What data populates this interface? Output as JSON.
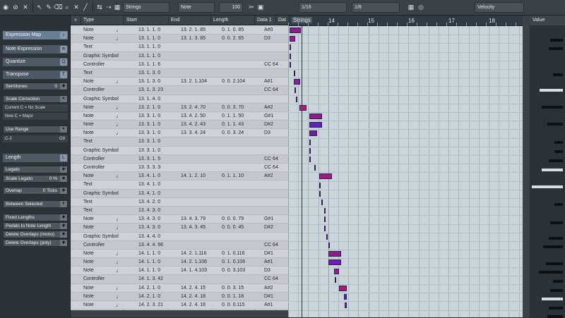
{
  "toolbar": {
    "strings_label": "Strings",
    "note_label": "Note",
    "velocity_value": "100",
    "quantize_label": "1/16",
    "length_label": "1/8",
    "controller_label": "Velocity",
    "icons": [
      "solo-icon",
      "mute-icon",
      "listen-icon",
      "arrow-icon",
      "pencil-icon",
      "eraser-icon",
      "zoom-icon",
      "mute-tool-icon",
      "line-icon",
      "autoscroll-icon",
      "insert-velocity-icon",
      "snap-icon",
      "colors-icon"
    ]
  },
  "inspector": {
    "expression_map": "Expression Map",
    "note_expression": "Note Expression",
    "quantize": "Quantize",
    "transpose": "Transpose",
    "semitones_label": "Semitones",
    "semitones_value": "0",
    "scale_correction": "Scale Correction",
    "current_label": "Current",
    "current_root": "C",
    "current_scale": "No Scale",
    "new_label": "New",
    "new_root": "C",
    "new_scale": "Major",
    "use_range": "Use Range",
    "range_low": "C-2",
    "range_high": "G8",
    "length": "Length",
    "legato": "Legato",
    "scale_legato_label": "Scale Legato",
    "scale_legato_value": "0 %",
    "overlap_label": "Overlap",
    "overlap_value": "0 Ticks",
    "between_selected": "Between Selected",
    "fixed_lengths": "Fixed Lengths",
    "pedals_to_note_length": "Pedals to Note Length",
    "delete_overlaps_mono": "Delete Overlaps (mono)",
    "delete_overlaps_poly": "Delete Overlaps (poly)"
  },
  "list": {
    "headers": {
      "type": "Type",
      "start": "Start",
      "end": "End",
      "length": "Length",
      "data1": "Data 1",
      "data2": "Dat"
    },
    "rows": [
      {
        "type": "Note",
        "start": "13. 1. 1.  0",
        "end": "13. 2. 1. 85",
        "length": "0. 1. 0. 85",
        "data1": "A#0"
      },
      {
        "type": "Note",
        "start": "13. 1. 1.  0",
        "end": "13. 1. 3. 65",
        "length": "0. 0. 2. 65",
        "data1": "D3"
      },
      {
        "type": "Text",
        "start": "13. 1. 1.  0",
        "end": "",
        "length": "",
        "data1": ""
      },
      {
        "type": "Graphic Symbol",
        "start": "13. 1. 1.  0",
        "end": "",
        "length": "",
        "data1": ""
      },
      {
        "type": "Controller",
        "start": "13. 1. 1.  6",
        "end": "",
        "length": "",
        "data1": "CC 64"
      },
      {
        "type": "Text",
        "start": "13. 1. 3.  0",
        "end": "",
        "length": "",
        "data1": ""
      },
      {
        "type": "Note",
        "start": "13. 1. 3.  0",
        "end": "13. 2. 1.104",
        "length": "0. 0. 2.104",
        "data1": "A#1"
      },
      {
        "type": "Controller",
        "start": "13. 1. 3. 23",
        "end": "",
        "length": "",
        "data1": "CC 64"
      },
      {
        "type": "Graphic Symbol",
        "start": "13. 1. 4.  0",
        "end": "",
        "length": "",
        "data1": ""
      },
      {
        "type": "Note",
        "start": "13. 2. 1.  0",
        "end": "13. 2. 4. 70",
        "length": "0. 0. 3. 70",
        "data1": "A#2"
      },
      {
        "type": "Note",
        "start": "13. 3. 1.  0",
        "end": "13. 4. 2. 50",
        "length": "0. 1. 1. 50",
        "data1": "G#1"
      },
      {
        "type": "Note",
        "start": "13. 3. 1.  0",
        "end": "13. 4. 2. 43",
        "length": "0. 1. 1. 43",
        "data1": "D#2"
      },
      {
        "type": "Note",
        "start": "13. 3. 1.  0",
        "end": "13. 3. 4. 24",
        "length": "0. 0. 3. 24",
        "data1": "D3"
      },
      {
        "type": "Text",
        "start": "13. 3. 1.  0",
        "end": "",
        "length": "",
        "data1": ""
      },
      {
        "type": "Graphic Symbol",
        "start": "13. 3. 1.  0",
        "end": "",
        "length": "",
        "data1": ""
      },
      {
        "type": "Controller",
        "start": "13. 3. 1.  5",
        "end": "",
        "length": "",
        "data1": "CC 64"
      },
      {
        "type": "Controller",
        "start": "13. 3. 3.  3",
        "end": "",
        "length": "",
        "data1": "CC 64"
      },
      {
        "type": "Note",
        "start": "13. 4. 1.  0",
        "end": "14. 1. 2. 10",
        "length": "0. 1. 1. 10",
        "data1": "A#2"
      },
      {
        "type": "Text",
        "start": "13. 4. 1.  0",
        "end": "",
        "length": "",
        "data1": ""
      },
      {
        "type": "Graphic Symbol",
        "start": "13. 4. 1.  0",
        "end": "",
        "length": "",
        "data1": ""
      },
      {
        "type": "Text",
        "start": "13. 4. 2.  0",
        "end": "",
        "length": "",
        "data1": ""
      },
      {
        "type": "Text",
        "start": "13. 4. 3.  0",
        "end": "",
        "length": "",
        "data1": ""
      },
      {
        "type": "Note",
        "start": "13. 4. 3.  0",
        "end": "13. 4. 3. 79",
        "length": "0. 0. 0. 79",
        "data1": "G#1"
      },
      {
        "type": "Note",
        "start": "13. 4. 3.  0",
        "end": "13. 4. 3. 45",
        "length": "0. 0. 0. 45",
        "data1": "D#2"
      },
      {
        "type": "Graphic Symbol",
        "start": "13. 4. 4.  0",
        "end": "",
        "length": "",
        "data1": ""
      },
      {
        "type": "Controller",
        "start": "13. 4. 4. 96",
        "end": "",
        "length": "",
        "data1": "CC 64"
      },
      {
        "type": "Note",
        "start": "14. 1. 1.  0",
        "end": "14. 2. 1.116",
        "length": "0. 1. 0.116",
        "data1": "D#1"
      },
      {
        "type": "Note",
        "start": "14. 1. 1.  0",
        "end": "14. 2. 1.106",
        "length": "0. 1. 0.106",
        "data1": "A#1"
      },
      {
        "type": "Note",
        "start": "14. 1. 1.  0",
        "end": "14. 1. 4.103",
        "length": "0. 0. 3.103",
        "data1": "D3"
      },
      {
        "type": "Controller",
        "start": "14. 1. 3. 42",
        "end": "",
        "length": "",
        "data1": "CC 64"
      },
      {
        "type": "Note",
        "start": "14. 2. 1.  0",
        "end": "14. 2. 4. 15",
        "length": "0. 0. 3. 15",
        "data1": "A#2"
      },
      {
        "type": "Note",
        "start": "14. 2. 1.  0",
        "end": "14. 2. 4. 18",
        "length": "0. 0. 1. 18",
        "data1": "D#1"
      },
      {
        "type": "Note",
        "start": "14. 2. 3. 21",
        "end": "14. 2. 4. 16",
        "length": "0. 0. 0.115",
        "data1": "A#1"
      }
    ]
  },
  "grid": {
    "part_label": "Strings",
    "bars": [
      "14",
      "15",
      "16",
      "17",
      "18"
    ]
  },
  "value_column": {
    "header": "Value"
  }
}
